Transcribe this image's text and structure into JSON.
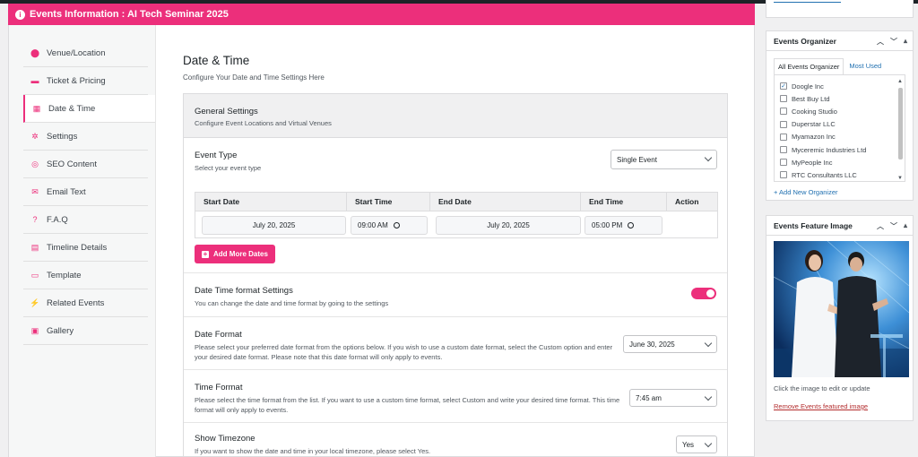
{
  "header": {
    "title": "Events Information : AI Tech Seminar 2025"
  },
  "sidebar": {
    "items": [
      {
        "label": "Venue/Location",
        "icon": "location-pin-icon",
        "glyph": "⬤"
      },
      {
        "label": "Ticket & Pricing",
        "icon": "ticket-icon",
        "glyph": "▬"
      },
      {
        "label": "Date & Time",
        "icon": "calendar-icon",
        "glyph": "▦"
      },
      {
        "label": "Settings",
        "icon": "gears-icon",
        "glyph": "✲"
      },
      {
        "label": "SEO Content",
        "icon": "search-icon",
        "glyph": "◎"
      },
      {
        "label": "Email Text",
        "icon": "envelope-icon",
        "glyph": "✉"
      },
      {
        "label": "F.A.Q",
        "icon": "question-icon",
        "glyph": "?"
      },
      {
        "label": "Timeline Details",
        "icon": "timeline-icon",
        "glyph": "▤"
      },
      {
        "label": "Template",
        "icon": "template-icon",
        "glyph": "▭"
      },
      {
        "label": "Related Events",
        "icon": "plug-icon",
        "glyph": "⚡"
      },
      {
        "label": "Gallery",
        "icon": "gallery-icon",
        "glyph": "▣"
      }
    ],
    "active_index": 2
  },
  "main": {
    "title": "Date & Time",
    "subtitle": "Configure Your Date and Time Settings Here",
    "general": {
      "title": "General Settings",
      "desc": "Configure Event Locations and Virtual Venues"
    },
    "event_type": {
      "label": "Event Type",
      "desc": "Select your event type",
      "value": "Single Event"
    },
    "dates_table": {
      "headers": [
        "Start Date",
        "Start Time",
        "End Date",
        "End Time",
        "Action"
      ],
      "start_date": "July 20, 2025",
      "start_time": "09:00 AM",
      "end_date": "July 20, 2025",
      "end_time": "05:00 PM"
    },
    "add_button": "Add More Dates",
    "format_settings": {
      "label": "Date Time format Settings",
      "desc": "You can change the date and time format by going to the settings",
      "enabled": true
    },
    "date_format": {
      "label": "Date Format",
      "desc": "Please select your preferred date format from the options below. If you wish to use a custom date format, select the Custom option and enter your desired date format. Please note that this date format will only apply to events.",
      "value": "June 30, 2025"
    },
    "time_format": {
      "label": "Time Format",
      "desc": "Please select the time format from the list. If you want to use a custom time format, select Custom and write your desired time format. This time format will only apply to events.",
      "value": "7:45 am"
    },
    "timezone": {
      "label": "Show Timezone",
      "desc": "If you want to show the date and time in your local timezone, please select Yes.",
      "value": "Yes"
    }
  },
  "organizer": {
    "title": "Events Organizer",
    "tabs": [
      "All Events Organizer",
      "Most Used"
    ],
    "items": [
      {
        "label": "Doogle Inc",
        "checked": true
      },
      {
        "label": "Best Buy Ltd",
        "checked": false
      },
      {
        "label": "Cooking Studio",
        "checked": false
      },
      {
        "label": "Duperstar LLC",
        "checked": false
      },
      {
        "label": "Myamazon Inc",
        "checked": false
      },
      {
        "label": "Myceremic Industries Ltd",
        "checked": false
      },
      {
        "label": "MyPeople Inc",
        "checked": false
      },
      {
        "label": "RTC Consultants LLC",
        "checked": false
      }
    ],
    "add_link": "+ Add New Organizer"
  },
  "feature_image": {
    "title": "Events Feature Image",
    "hint": "Click the image to edit or update",
    "remove_link": "Remove Events featured image"
  },
  "colors": {
    "accent": "#ec2f7b",
    "link": "#2271b1",
    "danger": "#b32d2e"
  }
}
